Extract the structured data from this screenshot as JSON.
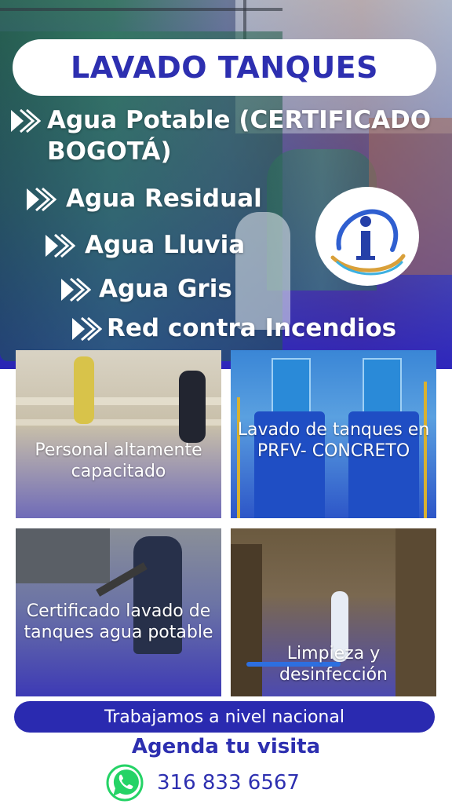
{
  "header": {
    "title": "LAVADO TANQUES"
  },
  "services": [
    {
      "label": "Agua Potable (CERTIFICADO BOGOTÁ)"
    },
    {
      "label": "Agua Residual"
    },
    {
      "label": "Agua Lluvia"
    },
    {
      "label": "Agua Gris"
    },
    {
      "label": "Red contra Incendios"
    }
  ],
  "tiles": [
    {
      "caption": "Personal altamente capacitado"
    },
    {
      "caption": "Lavado de tanques en PRFV- CONCRETO"
    },
    {
      "caption": "Certificado lavado de tanques agua potable"
    },
    {
      "caption": "Limpieza y desinfección"
    }
  ],
  "footer": {
    "coverage": "Trabajamos a nivel nacional",
    "cta": "Agenda tu visita",
    "phone": "316 833 6567"
  },
  "colors": {
    "brand": "#2d2fb0",
    "pill": "#2a2ab0",
    "whatsapp": "#25d366"
  },
  "icons": [
    "double-chevron-icon",
    "company-logo",
    "whatsapp-icon"
  ]
}
